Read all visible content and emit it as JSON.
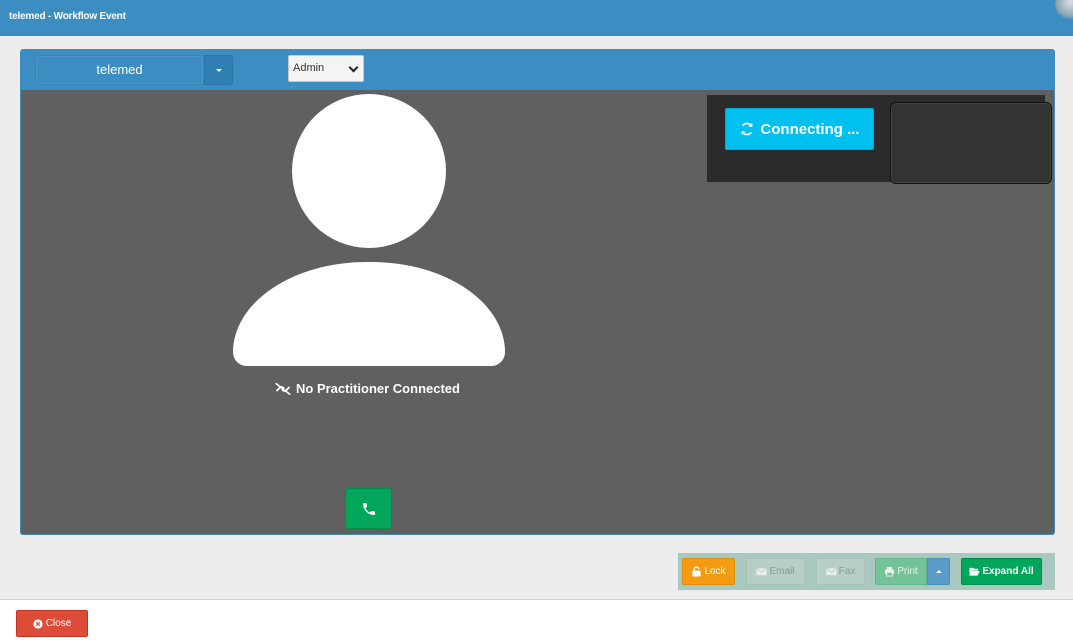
{
  "window": {
    "title": "telemed - Workflow Event"
  },
  "toolbar": {
    "group_label": "telemed",
    "role_select": {
      "value": "Admin"
    }
  },
  "stage": {
    "no_practitioner_text": "No Practitioner Connected",
    "connecting_label": "Connecting ..."
  },
  "actions": {
    "lock": "Lock",
    "email": "Email",
    "fax": "Fax",
    "print": "Print",
    "expand_all": "Expand All"
  },
  "footer": {
    "close": "Close"
  },
  "colors": {
    "primary": "#3c8dc1",
    "stage_bg": "#606060",
    "success": "#00a65a",
    "info": "#00c0ef",
    "warning": "#f39c12",
    "danger": "#dd4b39"
  },
  "icons": {
    "connecting": "sync-icon",
    "no_practitioner": "unlink-icon",
    "call": "phone-icon",
    "lock": "unlock-icon",
    "email": "envelope-icon",
    "fax": "envelope-icon",
    "print": "print-icon",
    "expand_all": "folder-open-icon",
    "close": "times-circle-icon"
  }
}
